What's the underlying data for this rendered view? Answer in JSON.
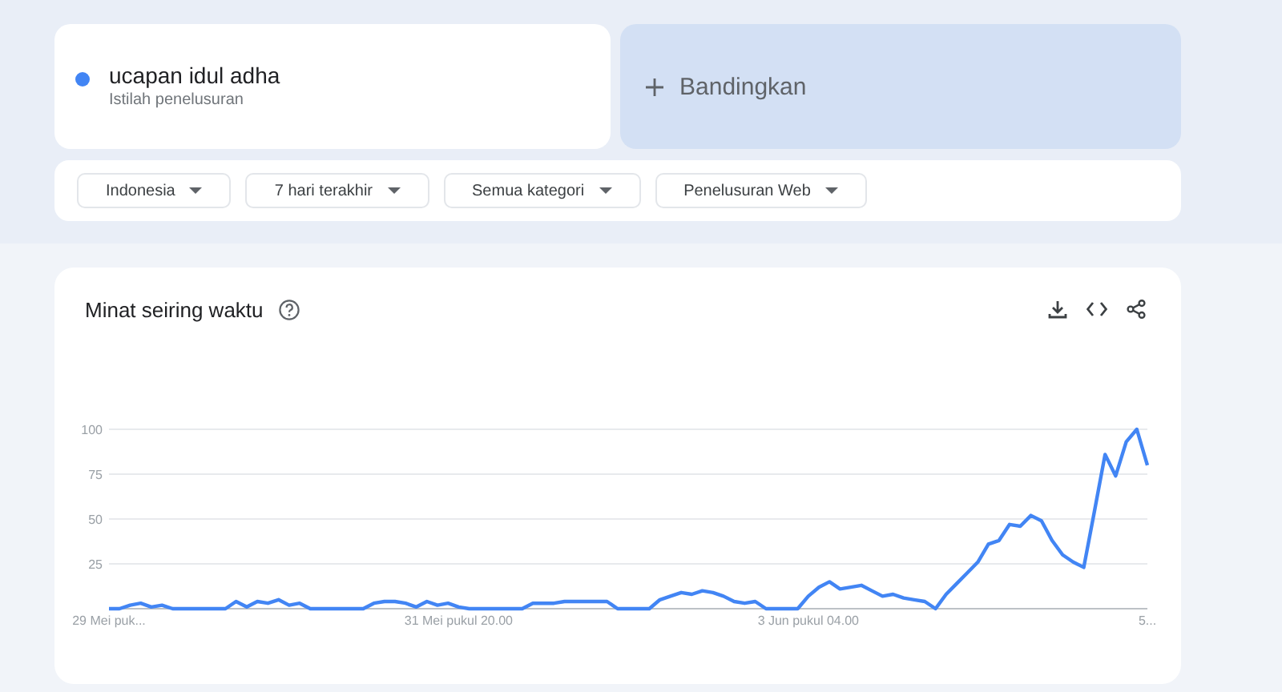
{
  "search_terms": [
    {
      "term": "ucapan idul adha",
      "subtitle": "Istilah penelusuran",
      "color": "#4285f4"
    }
  ],
  "compare": {
    "label": "Bandingkan"
  },
  "filters": [
    {
      "label": "Indonesia"
    },
    {
      "label": "7 hari terakhir"
    },
    {
      "label": "Semua kategori"
    },
    {
      "label": "Penelusuran Web"
    }
  ],
  "interest_over_time": {
    "title": "Minat seiring waktu",
    "chart_data": {
      "type": "line",
      "ylim": [
        0,
        100
      ],
      "yticks": [
        25,
        50,
        75,
        100
      ],
      "grid": true,
      "categories": [
        "29 Mei puk...",
        null,
        null,
        null,
        null,
        null,
        null,
        null,
        null,
        null,
        null,
        null,
        null,
        null,
        null,
        null,
        null,
        null,
        null,
        null,
        null,
        null,
        null,
        null,
        null,
        null,
        null,
        null,
        null,
        null,
        null,
        null,
        null,
        "31 Mei pukul 20.00",
        null,
        null,
        null,
        null,
        null,
        null,
        null,
        null,
        null,
        null,
        null,
        null,
        null,
        null,
        null,
        null,
        null,
        null,
        null,
        null,
        null,
        null,
        null,
        null,
        null,
        null,
        null,
        null,
        null,
        null,
        null,
        null,
        "3 Jun pukul 04.00",
        null,
        null,
        null,
        null,
        null,
        null,
        null,
        null,
        null,
        null,
        null,
        null,
        null,
        null,
        null,
        null,
        null,
        null,
        null,
        null,
        null,
        null,
        null,
        null,
        null,
        null,
        null,
        null,
        null,
        null,
        null,
        "5..."
      ],
      "series": [
        {
          "color": "#4285f4",
          "values": [
            0,
            0,
            2,
            3,
            1,
            2,
            0,
            0,
            0,
            0,
            0,
            0,
            4,
            1,
            4,
            3,
            5,
            2,
            3,
            0,
            0,
            0,
            0,
            0,
            0,
            3,
            4,
            4,
            3,
            1,
            4,
            2,
            3,
            1,
            0,
            0,
            0,
            0,
            0,
            0,
            3,
            3,
            3,
            4,
            4,
            4,
            4,
            4,
            0,
            0,
            0,
            0,
            5,
            7,
            9,
            8,
            10,
            9,
            7,
            4,
            3,
            4,
            0,
            0,
            0,
            0,
            7,
            12,
            15,
            11,
            12,
            13,
            10,
            7,
            8,
            6,
            5,
            4,
            0,
            8,
            14,
            20,
            26,
            36,
            38,
            47,
            46,
            52,
            49,
            38,
            30,
            26,
            23,
            54,
            86,
            74,
            93,
            100,
            80
          ]
        }
      ]
    }
  }
}
